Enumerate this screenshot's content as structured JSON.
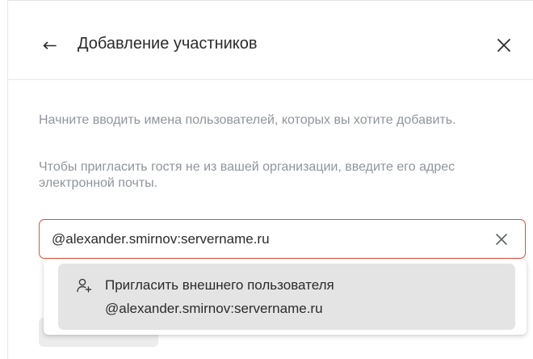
{
  "dialog": {
    "title": "Добавление участников",
    "back_icon": "arrow-left-icon",
    "close_icon": "close-icon"
  },
  "hints": {
    "search_hint": "Начните вводить имена пользователей, которых вы хотите добавить.",
    "guest_hint": "Чтобы пригласить гостя не из вашей организации, введите его адрес электронной почты."
  },
  "search": {
    "value": "@alexander.smirnov:servername.ru",
    "accent_color": "#e0513b",
    "clear_icon": "clear-icon"
  },
  "suggestion": {
    "icon": "invite-user-icon",
    "label": "Пригласить внешнего пользователя",
    "address": "@alexander.smirnov:servername.ru"
  }
}
